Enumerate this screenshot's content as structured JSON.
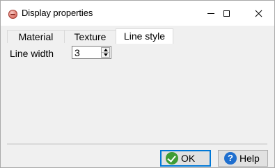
{
  "window": {
    "title": "Display properties",
    "icon": "app-icon"
  },
  "titlebar_buttons": {
    "minimize": "minimize-icon",
    "maximize": "maximize-icon",
    "close": "close-icon"
  },
  "tabs": [
    {
      "label": "Material",
      "active": false
    },
    {
      "label": "Texture",
      "active": false
    },
    {
      "label": "Line style",
      "active": true
    }
  ],
  "line_style": {
    "line_width_label": "Line width",
    "line_width_value": "3"
  },
  "buttons": {
    "ok_label": "OK",
    "help_label": "Help",
    "ok_icon": "checkmark-icon",
    "help_icon_glyph": "?"
  },
  "colors": {
    "ok_icon": "#3f9c35",
    "help_icon": "#1f6fcf",
    "focus_border": "#0078d7"
  }
}
